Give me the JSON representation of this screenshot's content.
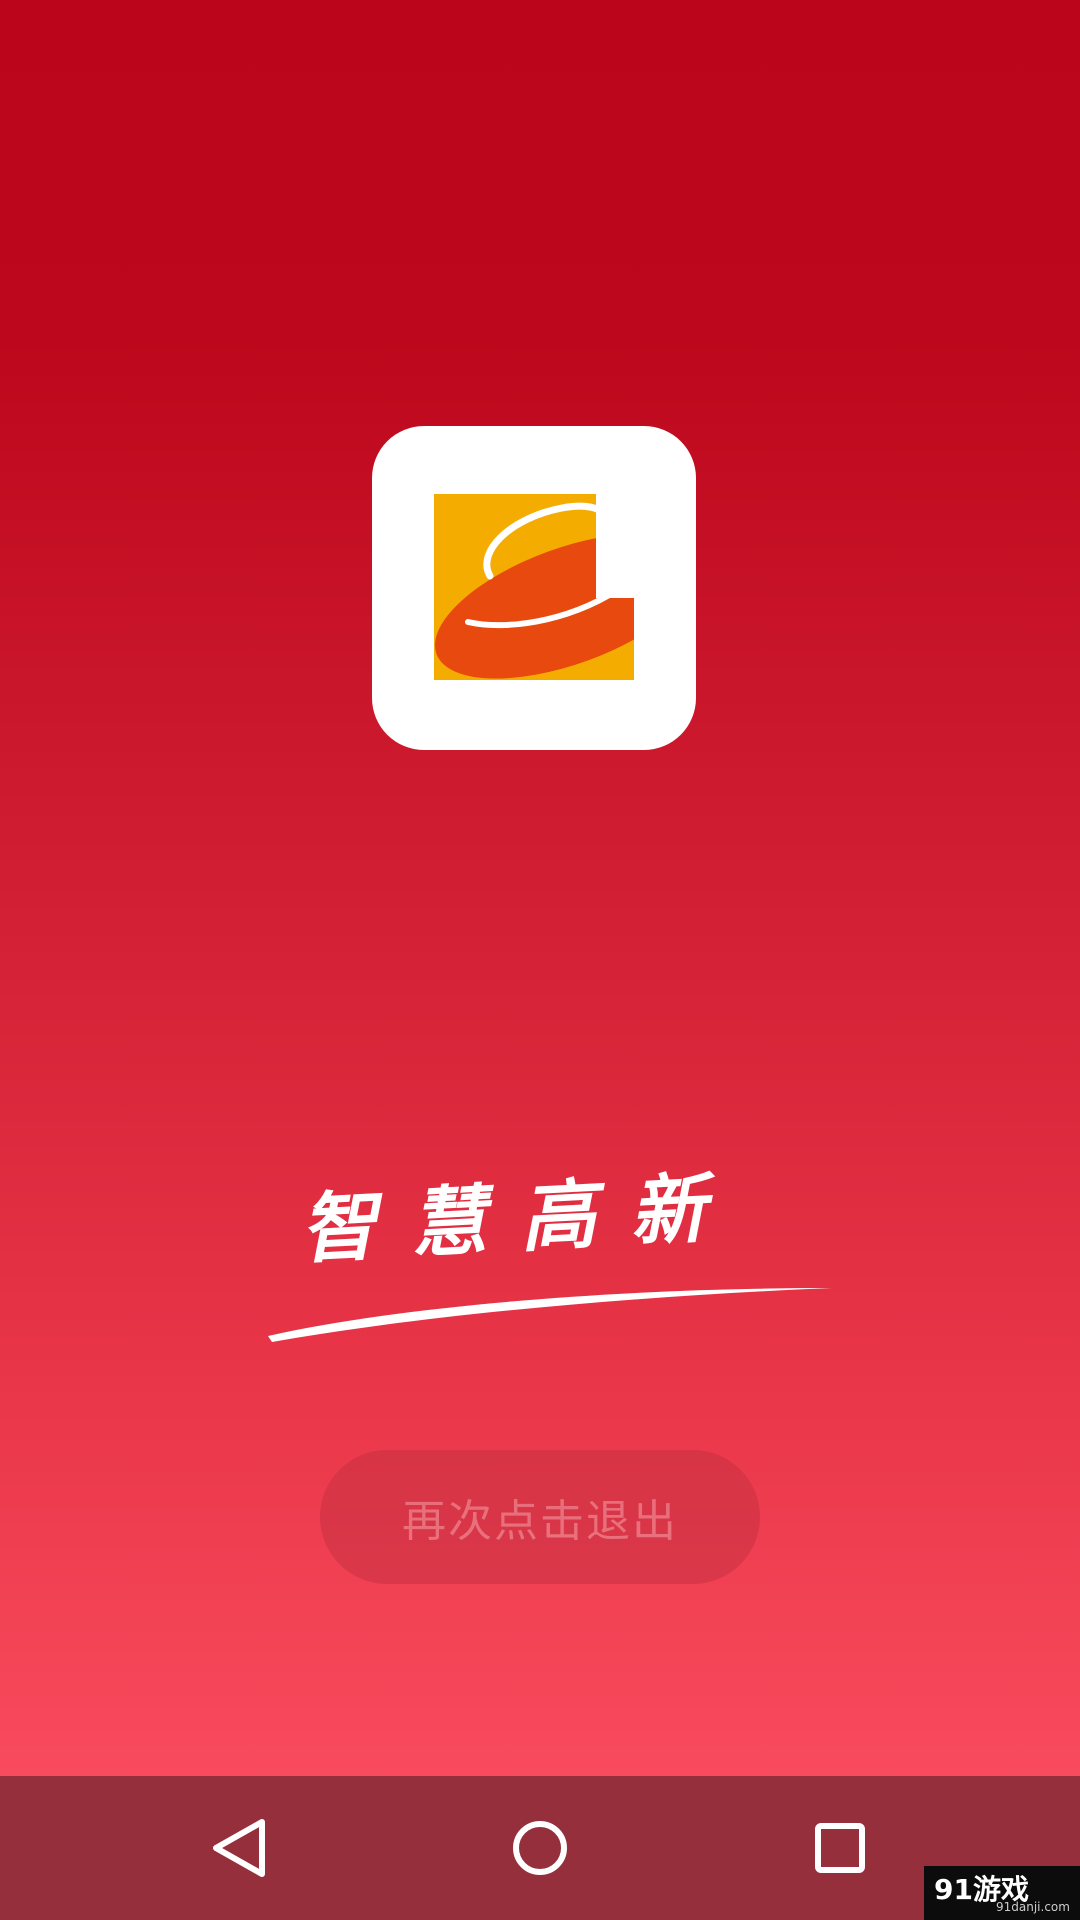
{
  "app": {
    "logo_icon": "app-logo-icon",
    "slogan": "智慧高新"
  },
  "toast": {
    "message": "再次点击退出"
  },
  "navbar": {
    "back_icon": "back-triangle-icon",
    "home_icon": "home-circle-icon",
    "recent_icon": "recent-apps-square-icon"
  },
  "watermark": {
    "brand": "91游戏",
    "site": "91danji.com"
  },
  "colors": {
    "splash_top": "#bb051b",
    "splash_bottom": "#f84b5d",
    "navbar": "#942f3b",
    "logo_yellow": "#f4ac00",
    "logo_orange": "#e8490f"
  }
}
